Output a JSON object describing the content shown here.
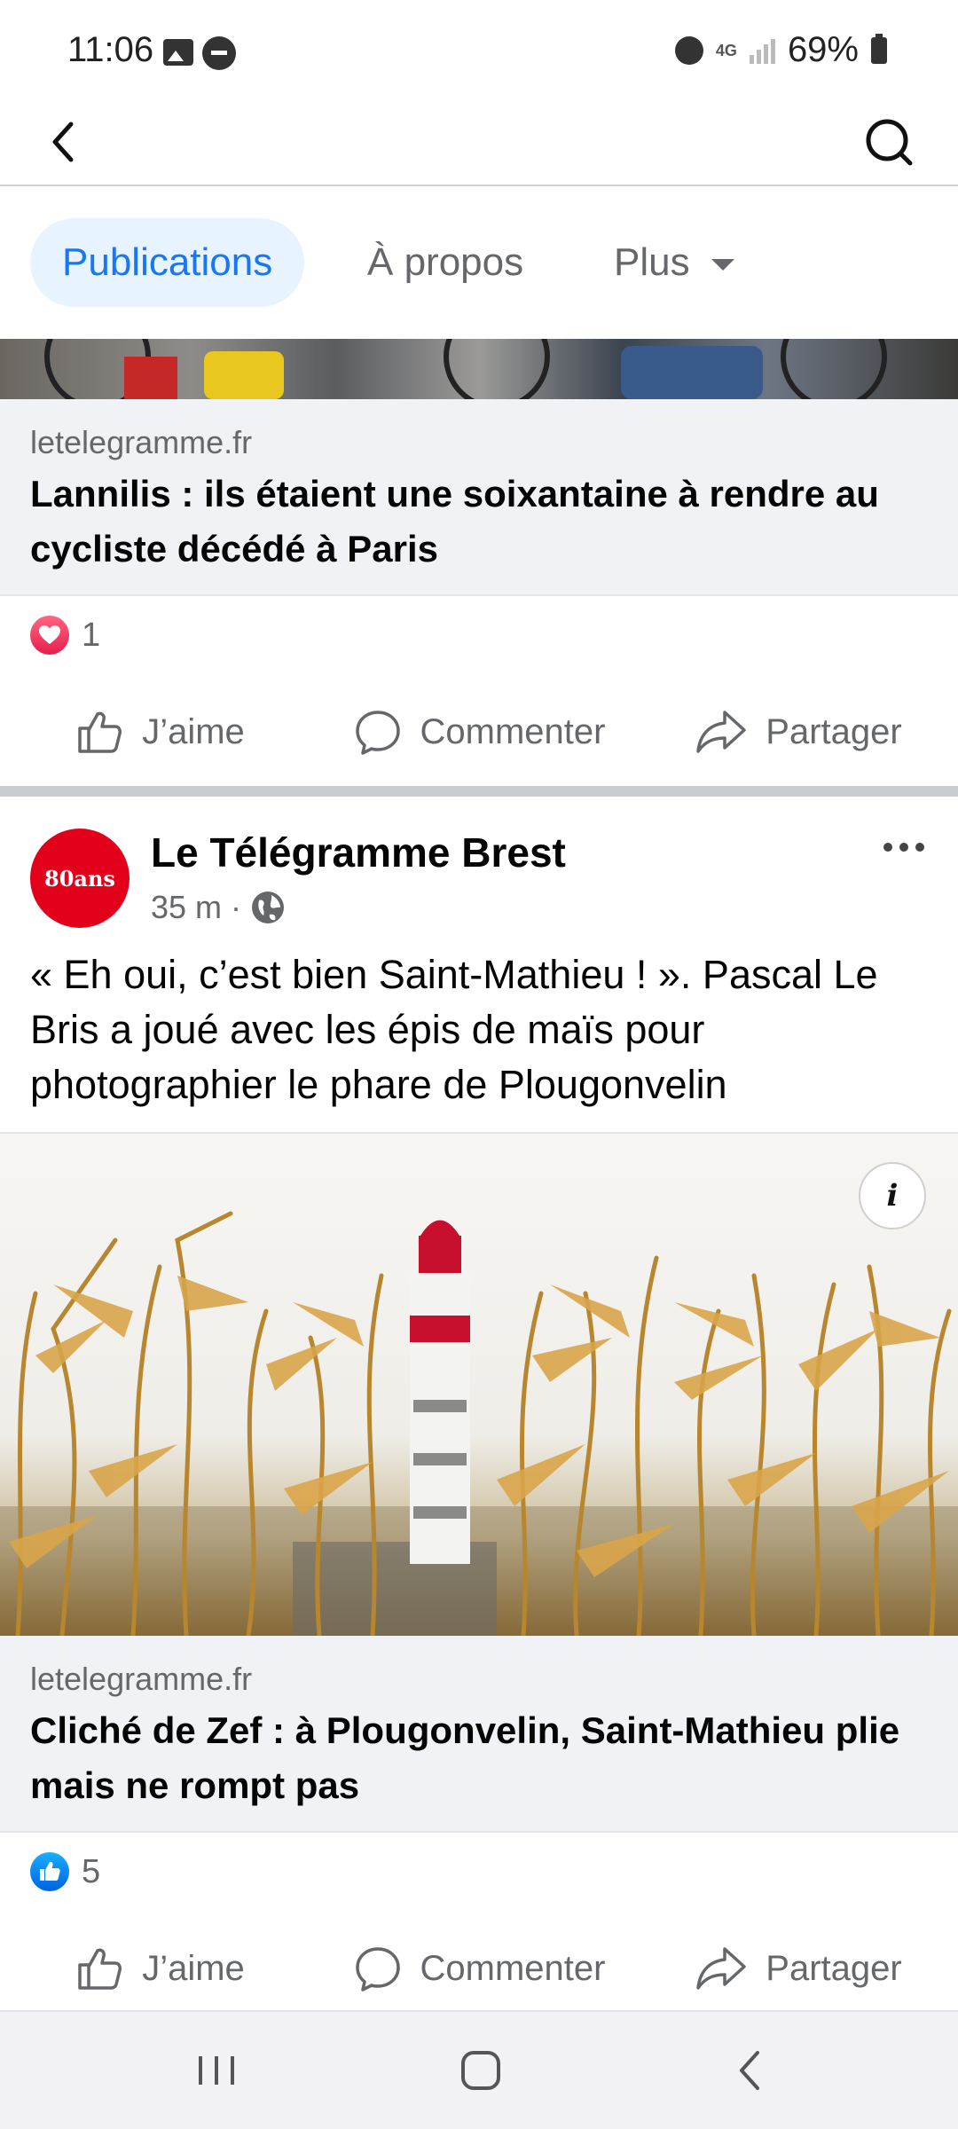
{
  "status_bar": {
    "time": "11:06",
    "network": "4G",
    "battery": "69%"
  },
  "tabs": {
    "publications": "Publications",
    "apropos": "À propos",
    "plus": "Plus"
  },
  "post1": {
    "domain": "letelegramme.fr",
    "title": "Lannilis : ils étaient une soixantaine à rendre au cycliste décédé à Paris",
    "reaction_count": "1"
  },
  "post2": {
    "page_name": "Le Télégramme Brest",
    "avatar_text": "80ans",
    "time": "35 m ·",
    "text": "« Eh oui, c’est bien Saint-Mathieu ! ». Pascal Le Bris a joué avec les épis de maïs pour photographier le phare de Plougonvelin",
    "info_label": "i",
    "domain": "letelegramme.fr",
    "title": "Cliché de Zef : à Plougonvelin, Saint-Mathieu plie mais ne rompt pas",
    "reaction_count": "5"
  },
  "actions": {
    "like": "J’aime",
    "comment": "Commenter",
    "share": "Partager"
  },
  "icons": {
    "back": "back-arrow-icon",
    "search": "search-icon",
    "dropdown": "caret-down-icon",
    "love": "love-reaction-icon",
    "like": "like-reaction-icon",
    "globe": "globe-icon",
    "more": "more-options-icon",
    "info": "info-icon",
    "nav": [
      "recent-apps-icon",
      "home-icon",
      "back-nav-icon"
    ]
  },
  "colors": {
    "accent": "#1877f2",
    "tab_bg": "#e7f3ff",
    "love": "#e61e4d",
    "avatar": "#e2001a"
  }
}
